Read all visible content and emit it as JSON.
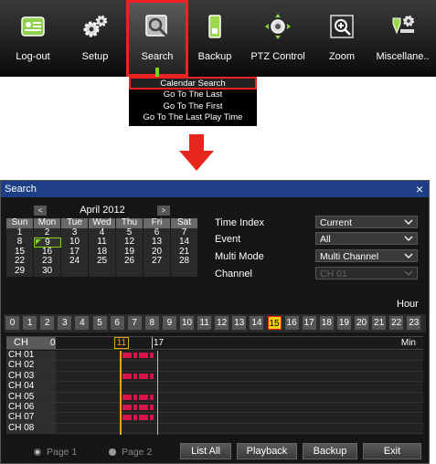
{
  "toolbar": {
    "items": [
      {
        "label": "Log-out",
        "icon": "logout-icon"
      },
      {
        "label": "Setup",
        "icon": "gears-icon"
      },
      {
        "label": "Search",
        "icon": "search-icon"
      },
      {
        "label": "Backup",
        "icon": "backup-icon"
      },
      {
        "label": "PTZ Control",
        "icon": "ptz-icon"
      },
      {
        "label": "Zoom",
        "icon": "zoom-icon"
      },
      {
        "label": "Miscellane..",
        "icon": "misc-icon"
      }
    ],
    "active_index": 2,
    "active_color": "#e22222"
  },
  "search_menu": {
    "items": [
      "Calendar Search",
      "Go To The Last",
      "Go To The First",
      "Go To The Last Play Time"
    ],
    "selected_index": 0
  },
  "dialog": {
    "title": "Search",
    "close_label": "×",
    "title_bar_color": "#1e3f86",
    "calendar": {
      "prev_label": "<",
      "next_label": ">",
      "month_title": "April 2012",
      "weekdays": [
        "Sun",
        "Mon",
        "Tue",
        "Wed",
        "Thu",
        "Fri",
        "Sat"
      ],
      "weeks": [
        [
          "1",
          "2",
          "3",
          "4",
          "5",
          "6",
          "7"
        ],
        [
          "8",
          "9",
          "10",
          "11",
          "12",
          "13",
          "14"
        ],
        [
          "15",
          "16",
          "17",
          "18",
          "19",
          "20",
          "21"
        ],
        [
          "22",
          "23",
          "24",
          "25",
          "26",
          "27",
          "28"
        ],
        [
          "29",
          "30",
          "",
          "",
          "",
          "",
          ""
        ]
      ],
      "selected_day": "9"
    },
    "options": {
      "time_index": {
        "label": "Time Index",
        "value": "Current"
      },
      "event": {
        "label": "Event",
        "value": "All"
      },
      "multi_mode": {
        "label": "Multi Mode",
        "value": "Multi Channel"
      },
      "channel": {
        "label": "Channel",
        "value": "CH 01"
      }
    },
    "hour_label": "Hour",
    "hours": [
      "0",
      "1",
      "2",
      "3",
      "4",
      "5",
      "6",
      "7",
      "8",
      "9",
      "10",
      "11",
      "12",
      "13",
      "14",
      "15",
      "16",
      "17",
      "18",
      "19",
      "20",
      "21",
      "22",
      "23"
    ],
    "selected_hour": "15",
    "timeline": {
      "ch_label": "CH",
      "min_start": "0",
      "marker_a": "11",
      "marker_b": "17",
      "min_label": "Min",
      "channels": [
        "CH 01",
        "CH 02",
        "CH 03",
        "CH 04",
        "CH 05",
        "CH 06",
        "CH 07",
        "CH 08"
      ],
      "recorded": [
        true,
        false,
        true,
        false,
        true,
        true,
        true,
        false
      ],
      "record_color": "#d8144a"
    },
    "paging": {
      "page1": "Page 1",
      "page2": "Page 2"
    },
    "buttons": {
      "list_all": "List All",
      "playback": "Playback",
      "backup": "Backup",
      "exit": "Exit"
    }
  }
}
